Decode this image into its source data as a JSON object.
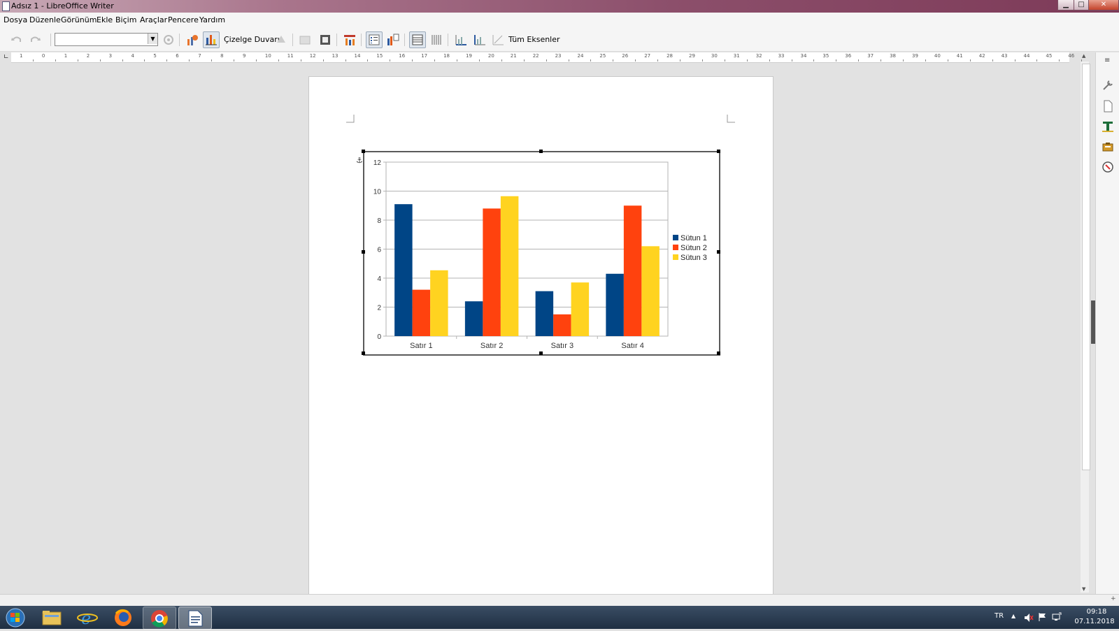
{
  "window": {
    "title": "Adsız 1 - LibreOffice Writer"
  },
  "menu": [
    "Dosya",
    "Düzenle",
    "Görünüm",
    "Ekle",
    "Biçim",
    "Araçlar",
    "Pencere",
    "Yardım"
  ],
  "toolbar": {
    "object_select_value": "",
    "chart_wall_label": "Çizelge Duvarı",
    "all_axes_label": "Tüm Eksenler"
  },
  "ruler": {
    "labels": [
      "1",
      "0",
      "1",
      "2",
      "3",
      "4",
      "5",
      "6",
      "7",
      "8",
      "9",
      "10",
      "11",
      "12",
      "13",
      "14",
      "15",
      "16",
      "17",
      "18",
      "19",
      "20",
      "21",
      "22",
      "23",
      "24",
      "25",
      "26",
      "27",
      "28",
      "29",
      "30",
      "31",
      "32",
      "33",
      "34",
      "35",
      "36",
      "37",
      "38",
      "39",
      "40",
      "41",
      "42",
      "43",
      "44",
      "45",
      "46"
    ]
  },
  "chart_data": {
    "type": "bar",
    "categories": [
      "Satır 1",
      "Satır 2",
      "Satır 3",
      "Satır 4"
    ],
    "series": [
      {
        "name": "Sütun 1",
        "color": "#004586",
        "values": [
          9.1,
          2.4,
          3.1,
          4.3
        ]
      },
      {
        "name": "Sütun 2",
        "color": "#ff420e",
        "values": [
          3.2,
          8.8,
          1.5,
          9.0
        ]
      },
      {
        "name": "Sütun 3",
        "color": "#ffd320",
        "values": [
          4.54,
          9.65,
          3.7,
          6.2
        ]
      }
    ],
    "title": "",
    "xlabel": "",
    "ylabel": "",
    "ylim": [
      0,
      12
    ],
    "yticks": [
      0,
      2,
      4,
      6,
      8,
      10,
      12
    ],
    "grid": true,
    "legend": "right"
  },
  "taskbar": {
    "apps": [
      "start-button",
      "file-explorer",
      "internet-explorer",
      "firefox",
      "chrome",
      "libreoffice-writer"
    ],
    "language": "TR",
    "time": "09:18",
    "date": "07.11.2018"
  }
}
